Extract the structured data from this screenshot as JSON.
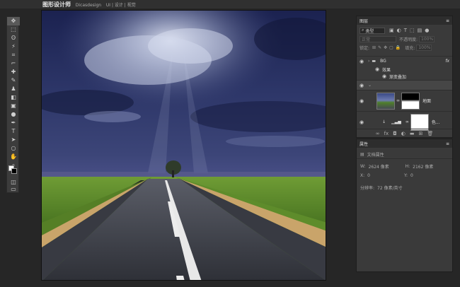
{
  "app": {
    "brand": "图形设计师",
    "brand_sub": "Dicasdesign",
    "brand_tags": "UI | 设计 | 视觉"
  },
  "tools": [
    {
      "icon": "move-icon",
      "glyph": "✥"
    },
    {
      "icon": "marquee-icon",
      "glyph": "⬚"
    },
    {
      "icon": "lasso-icon",
      "glyph": "ʘ"
    },
    {
      "icon": "magic-wand-icon",
      "glyph": "⚡"
    },
    {
      "icon": "crop-icon",
      "glyph": "⌗"
    },
    {
      "icon": "eyedropper-icon",
      "glyph": "⌐"
    },
    {
      "icon": "healing-brush-icon",
      "glyph": "✚"
    },
    {
      "icon": "brush-icon",
      "glyph": "✎"
    },
    {
      "icon": "stamp-icon",
      "glyph": "♟"
    },
    {
      "icon": "eraser-icon",
      "glyph": "◧"
    },
    {
      "icon": "gradient-icon",
      "glyph": "▣"
    },
    {
      "icon": "dodge-icon",
      "glyph": "●"
    },
    {
      "icon": "pen-icon",
      "glyph": "✒"
    },
    {
      "icon": "type-icon",
      "glyph": "T"
    },
    {
      "icon": "path-select-icon",
      "glyph": "➤"
    },
    {
      "icon": "ellipse-icon",
      "glyph": "○"
    },
    {
      "icon": "hand-icon",
      "glyph": "✋"
    },
    {
      "icon": "zoom-icon",
      "glyph": "⌕"
    },
    {
      "icon": "more-icon",
      "glyph": "⋯"
    }
  ],
  "layers_panel": {
    "title": "图层",
    "filter_label": "类型",
    "blend_mode": "正常",
    "opacity_label": "不透明度:",
    "opacity_value": "100%",
    "lock_label": "锁定:",
    "fill_label": "填充:",
    "fill_value": "100%",
    "layers": [
      {
        "name": "BG",
        "kind": "group"
      },
      {
        "name": "效果",
        "kind": "effects"
      },
      {
        "name": "渐变叠加",
        "kind": "effect"
      },
      {
        "name": "",
        "kind": "collapsed-group"
      },
      {
        "name": "地面",
        "kind": "image"
      },
      {
        "name": "色...",
        "kind": "adjustment"
      }
    ]
  },
  "properties_panel": {
    "title": "属性",
    "doc_label": "文档属性",
    "w_label": "W:",
    "w_value": "2624 像素",
    "h_label": "H:",
    "h_value": "2162 像素",
    "x_label": "X:",
    "x_value": "0",
    "y_label": "Y:",
    "y_value": "0",
    "resolution_label": "分辨率:",
    "resolution_value": "72 像素/英寸"
  },
  "colors": {
    "sky_dark": "#1d2450",
    "sky_mid": "#3a4478",
    "grass": "#5c8a2a",
    "road": "#3b3d44",
    "sand": "#c9a46a",
    "app_bg": "#262626",
    "panel_bg": "#3a3a3a"
  }
}
